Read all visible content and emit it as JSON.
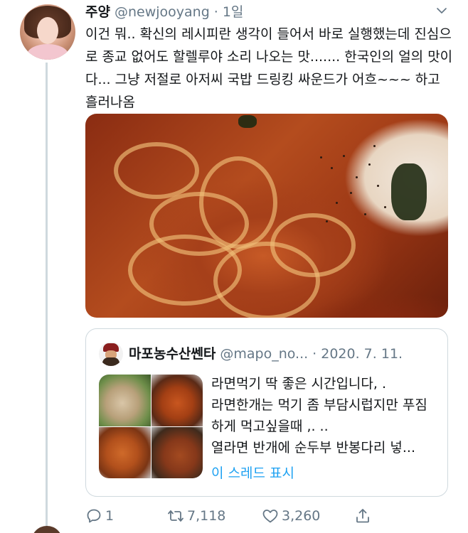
{
  "tweet": {
    "display_name": "주양",
    "handle": "@newjooyang",
    "time": "· 1일",
    "text": "이건 뭐.. 확신의 레시피란 생각이 들어서 바로 실행했는데 진심으로 종교 없어도 할렐루야 소리 나오는 맛....... 한국인의 얼의 맛이다... 그냥 저절로 아저씨 국밥 드링킹 싸운드가 어흐~~~ 하고 흘러나옴",
    "media_icon": "ramen-photo",
    "more_icon": "chevron-down-icon"
  },
  "quote": {
    "display_name": "마포농수산쎈타",
    "handle": "@mapo_no...",
    "date": "· 2020. 7. 11.",
    "text": "라면먹기 딱 좋은 시간입니다, .\n라면한개는 먹기 좀 부담시럽지만 푸짐하게 먹고싶을때 ,. ..\n열라면 반개에 순두부 반봉다리 넣...",
    "show_thread": "이 스레드 표시"
  },
  "actions": {
    "reply_count": "1",
    "retweet_count": "7,118",
    "like_count": "3,260"
  },
  "colors": {
    "link": "#1da1f2",
    "muted": "#657786",
    "text": "#14171a",
    "border": "#cfd9de"
  }
}
